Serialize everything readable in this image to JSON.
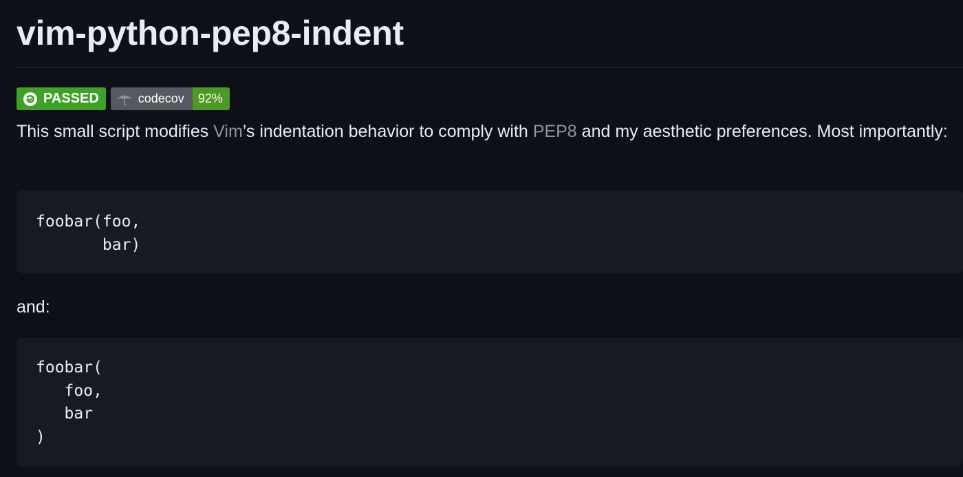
{
  "readme": {
    "title": "vim-python-pep8-indent",
    "badges": {
      "build_status": "PASSED",
      "coverage_label": "codecov",
      "coverage_value": "92%"
    },
    "intro": {
      "text_1": "This small script modifies ",
      "link_vim": "Vim",
      "text_2": "’s indentation behavior to comply with ",
      "link_pep8": "PEP8",
      "text_3": " and my aesthetic preferences. Most importantly:"
    },
    "code_example_1": "foobar(foo,\n       bar)",
    "and_text": "and:",
    "code_example_2": "foobar(\n   foo,\n   bar\n)"
  },
  "colors": {
    "background": "#0d1117",
    "code_background": "#161b22",
    "passed_badge": "#3fa126",
    "coverage_badge": "#4c9a1f",
    "link": "#8a9a9c"
  },
  "icons": {
    "passed": "refresh-check-icon",
    "codecov": "umbrella-icon"
  }
}
